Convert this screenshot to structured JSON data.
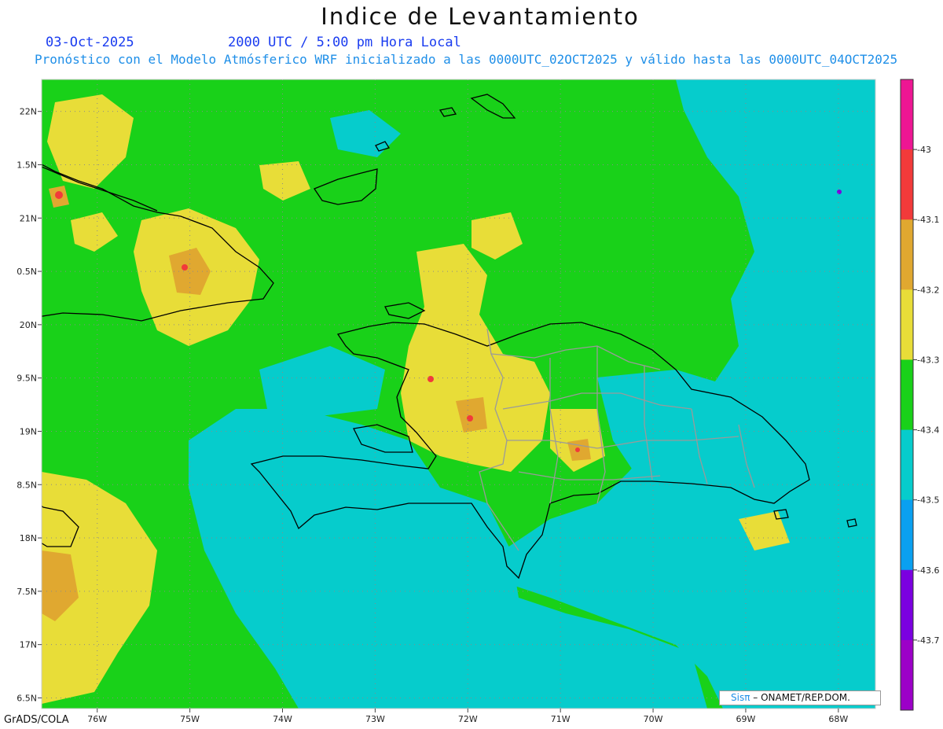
{
  "header": {
    "title": "Indice de Levantamiento",
    "date": "03-Oct-2025",
    "valid_time": "2000 UTC / 5:00 pm Hora Local",
    "subtitle": "Pronóstico con el Modelo Atmósferico WRF inicializado a las 0000UTC_02OCT2025 y válido hasta las  0000UTC_04OCT2025"
  },
  "map": {
    "lat_range": [
      16.4,
      22.3
    ],
    "lon_range": [
      -76.6,
      -67.6
    ],
    "lat_labels": [
      "22N",
      "1.5N",
      "21N",
      "0.5N",
      "20N",
      "9.5N",
      "19N",
      "8.5N",
      "18N",
      "7.5N",
      "17N",
      "6.5N"
    ],
    "lon_labels": [
      "76W",
      "75W",
      "74W",
      "73W",
      "72W",
      "71W",
      "70W",
      "69W",
      "68W"
    ],
    "colors": {
      "green": "#19d119",
      "cyan": "#06cccc",
      "yellow": "#e8dd38",
      "orange": "#e0a830",
      "red": "#f23a3a"
    }
  },
  "colorbar": {
    "labels": [
      "-43",
      "-43.1",
      "-43.2",
      "-43.3",
      "-43.4",
      "-43.5",
      "-43.6",
      "-43.7"
    ],
    "colors": [
      "#ee1693",
      "#f23a3a",
      "#e0a830",
      "#e8dd38",
      "#19d119",
      "#06cccc",
      "#0aa0f0",
      "#7b00e0",
      "#9c00c8"
    ]
  },
  "credits": {
    "sis": "Sis",
    "pi": "π",
    "org": " – ONAMET/REP.DOM.",
    "grads": "GrADS/COLA"
  }
}
